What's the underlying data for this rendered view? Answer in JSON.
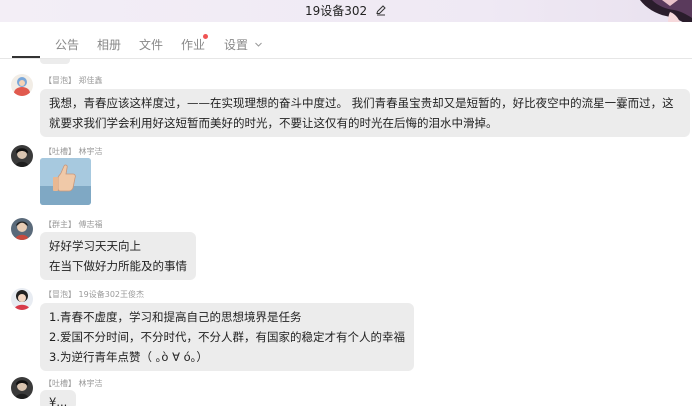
{
  "window": {
    "title": "19设备302"
  },
  "tabs": [
    {
      "label": "公告"
    },
    {
      "label": "相册"
    },
    {
      "label": "文件"
    },
    {
      "label": "作业"
    },
    {
      "label": "设置"
    }
  ],
  "messages": [
    {
      "role": "【冒泡】",
      "sender": "郑佳鑫",
      "lines": [
        "我想，青春应该这样度过，——在实现理想的奋斗中度过。 我们青春虽宝贵却又是短暂的，好比夜空中的流星一霎而过，这",
        "就要求我们学会利用好这短暂而美好的时光，不要让这仅有的时光在后悔的泪水中滑掉。"
      ]
    },
    {
      "role": "【吐槽】",
      "sender": "林宇洁",
      "image": "thumbs-up-sticker"
    },
    {
      "role": "【群主】",
      "sender": "傅志福",
      "lines": [
        "好好学习天天向上",
        "在当下做好力所能及的事情"
      ]
    },
    {
      "role": "【冒泡】",
      "sender": "19设备302王俊杰",
      "lines": [
        "1.青春不虚度，学习和提高自己的思想境界是任务",
        "2.爱国不分时间，不分时代，不分人群，有国家的稳定才有个人的幸福",
        "3.为逆行青年点赞（ ｡ò ∀ ó｡）"
      ]
    },
    {
      "role": "【吐槽】",
      "sender": "林宇洁",
      "lines": [
        "¥..."
      ]
    }
  ]
}
